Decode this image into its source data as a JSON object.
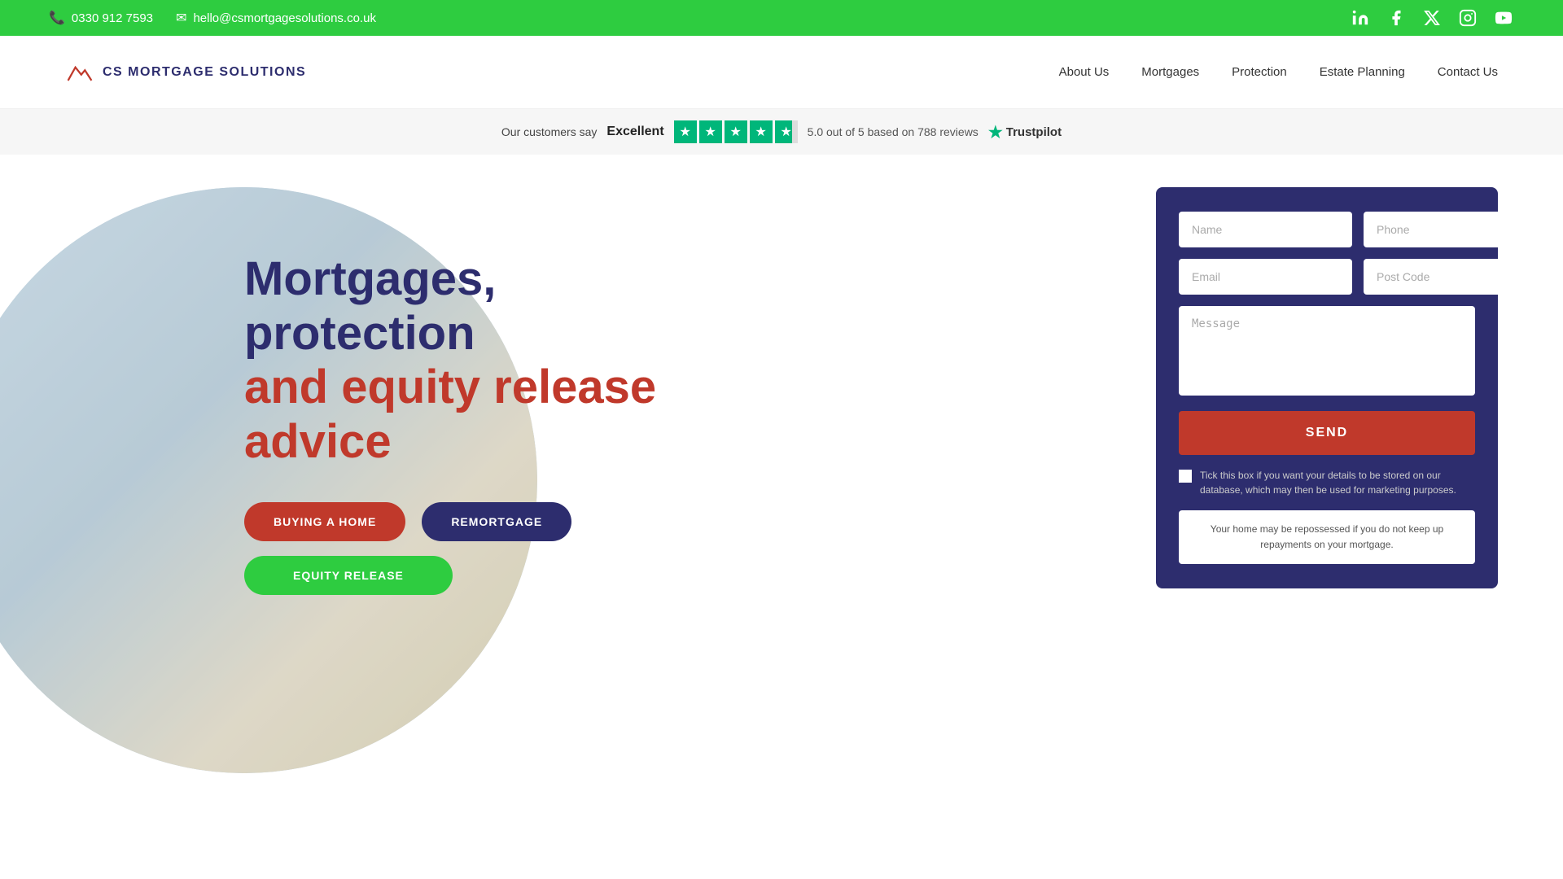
{
  "topbar": {
    "phone": "0330 912 7593",
    "email": "hello@csmortgagesolutions.co.uk",
    "social": [
      {
        "name": "linkedin-icon",
        "symbol": "in"
      },
      {
        "name": "facebook-icon",
        "symbol": "f"
      },
      {
        "name": "twitter-x-icon",
        "symbol": "𝕏"
      },
      {
        "name": "instagram-icon",
        "symbol": "◎"
      },
      {
        "name": "youtube-icon",
        "symbol": "▶"
      }
    ]
  },
  "nav": {
    "logo_text": "CS MORTGAGE SOLUTIONS",
    "links": [
      {
        "label": "About Us",
        "name": "nav-about-us"
      },
      {
        "label": "Mortgages",
        "name": "nav-mortgages"
      },
      {
        "label": "Protection",
        "name": "nav-protection"
      },
      {
        "label": "Estate Planning",
        "name": "nav-estate-planning"
      },
      {
        "label": "Contact Us",
        "name": "nav-contact-us"
      }
    ]
  },
  "trustpilot": {
    "prefix": "Our customers say",
    "rating_word": "Excellent",
    "score_text": "5.0 out of 5 based on 788 reviews",
    "brand": "Trustpilot"
  },
  "hero": {
    "title_line1": "Mortgages,",
    "title_line2": "protection",
    "title_line3": "and equity release",
    "title_line4": "advice",
    "btn_buying": "BUYING A HOME",
    "btn_remortgage": "REMORTGAGE",
    "btn_equity": "EQUITY RELEASE"
  },
  "form": {
    "name_placeholder": "Name",
    "phone_placeholder": "Phone",
    "email_placeholder": "Email",
    "postcode_placeholder": "Post Code",
    "message_placeholder": "Message",
    "send_label": "SEND",
    "checkbox_label": "Tick this box if you want your details to be stored on our database, which may then be used for marketing purposes.",
    "disclaimer": "Your home may be repossessed if you do not keep up repayments on your mortgage."
  }
}
